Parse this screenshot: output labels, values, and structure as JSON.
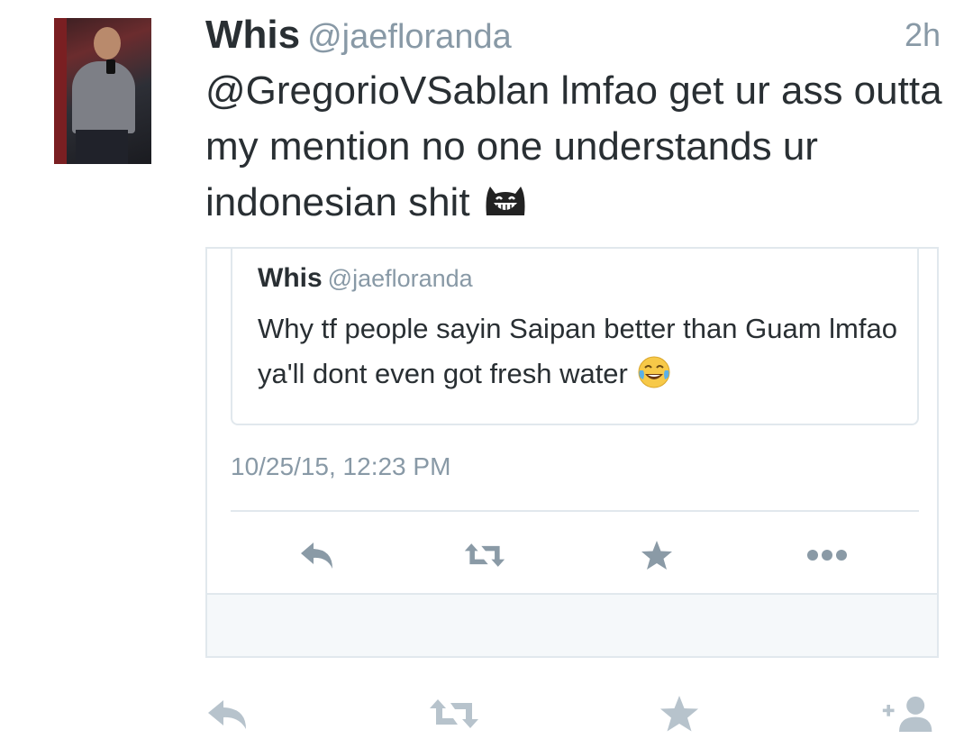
{
  "tweet": {
    "name": "Whis",
    "handle": "@jaefloranda",
    "time": "2h",
    "text": "@GregorioVSablan lmfao get ur ass outta my mention no one understands ur indonesian shit",
    "emoji": "grinning-cat-face-icon"
  },
  "quoted": {
    "name": "Whis",
    "handle": "@jaefloranda",
    "text": "Why tf people sayin Saipan better than Guam lmfao ya'll dont even got fresh water",
    "emoji": "face-with-tears-of-joy-icon",
    "timestamp": "10/25/15, 12:23 PM",
    "actions": [
      "reply-icon",
      "retweet-icon",
      "favorite-icon",
      "more-icon"
    ]
  },
  "actions": [
    "reply-icon",
    "retweet-icon",
    "favorite-icon",
    "follow-icon"
  ],
  "colors": {
    "text": "#292f33",
    "secondary": "#8899a6",
    "action_icon": "#b7c3cc",
    "card_icon": "#8a9aa6",
    "border": "#e1e8ed",
    "card_footer": "#f5f8fa"
  }
}
